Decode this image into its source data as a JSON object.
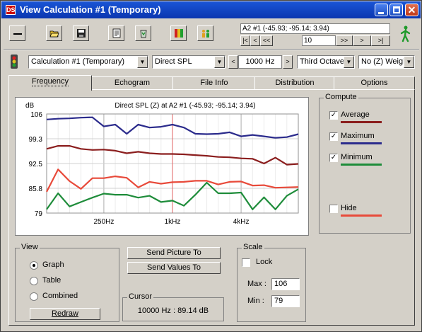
{
  "window": {
    "title": "View Calculation #1 (Temporary)",
    "app_icon_text": "DS"
  },
  "nav": {
    "location": "A2 #1  (-45.93; -95.14; 3.94)",
    "index": "10",
    "buttons": [
      "|<",
      "<",
      "<<",
      ">>",
      ">",
      ">|"
    ]
  },
  "selectors": {
    "calculation": "Calculation #1 (Temporary)",
    "parameter": "Direct SPL",
    "frequency": "1000 Hz",
    "band": "Third Octave",
    "weighting": "No (Z) Weight"
  },
  "tabs": [
    "Frequency",
    "Echogram",
    "File Info",
    "Distribution",
    "Options"
  ],
  "chart_data": {
    "type": "line",
    "title": "Direct SPL (Z) at A2 #1  (-45.93; -95.14; 3.94)",
    "ylabel": "dB",
    "ylim": [
      79,
      106
    ],
    "yticks": [
      "106",
      "99.3",
      "92.5",
      "85.8",
      "79"
    ],
    "xticks": [
      "250Hz",
      "1kHz",
      "4kHz"
    ],
    "cursor_x_label": "1kHz",
    "series": [
      {
        "name": "Maximum",
        "color": "#2b2b8c",
        "values": [
          104.5,
          104.7,
          104.8,
          105.0,
          105.1,
          102.6,
          103.1,
          100.6,
          103.1,
          102.3,
          102.5,
          103.1,
          102.3,
          100.6,
          100.5,
          100.6,
          101.0,
          99.9,
          100.3,
          99.9,
          99.5,
          99.7,
          100.5
        ]
      },
      {
        "name": "Average",
        "color": "#8b1e1e",
        "values": [
          96.5,
          97.3,
          97.3,
          96.5,
          96.2,
          96.3,
          96.0,
          95.3,
          95.7,
          95.3,
          95.1,
          95.1,
          95.0,
          94.8,
          94.6,
          94.3,
          94.2,
          93.9,
          93.8,
          92.5,
          94.1,
          92.2,
          92.4
        ]
      },
      {
        "name": "Minimum",
        "color": "#1e8c3a",
        "values": [
          80.0,
          84.4,
          80.8,
          82.0,
          83.2,
          84.3,
          84.0,
          84.0,
          83.2,
          83.7,
          82.0,
          82.4,
          81.0,
          84.0,
          87.3,
          84.4,
          84.4,
          84.6,
          80.0,
          83.3,
          80.0,
          83.7,
          85.5
        ]
      },
      {
        "name": "Hide",
        "color": "#e84a3a",
        "values": [
          84.8,
          90.9,
          87.7,
          85.6,
          88.5,
          88.5,
          89.0,
          88.6,
          86.0,
          87.5,
          87.0,
          87.4,
          87.5,
          87.8,
          87.8,
          86.8,
          87.5,
          87.6,
          86.5,
          86.6,
          85.9,
          86.0,
          86.1
        ]
      }
    ]
  },
  "compute": {
    "title": "Compute",
    "items": [
      {
        "label": "Average",
        "checked": true,
        "color": "#8b1e1e"
      },
      {
        "label": "Maximum",
        "checked": true,
        "color": "#2b2b8c"
      },
      {
        "label": "Minimum",
        "checked": true,
        "color": "#1e8c3a"
      },
      {
        "label": "Hide",
        "checked": false,
        "color": "#e84a3a"
      }
    ],
    "check_mark": "✓"
  },
  "view": {
    "title": "View",
    "options": [
      "Graph",
      "Table",
      "Combined"
    ],
    "selected": "Graph",
    "redraw": "Redraw"
  },
  "send": {
    "picture": "Send Picture To",
    "values": "Send Values To"
  },
  "cursor": {
    "title": "Cursor",
    "readout": "10000 Hz : 89.14 dB"
  },
  "scale": {
    "title": "Scale",
    "lock": "Lock",
    "max_label": "Max :",
    "max": "106",
    "min_label": "Min :",
    "min": "79"
  }
}
